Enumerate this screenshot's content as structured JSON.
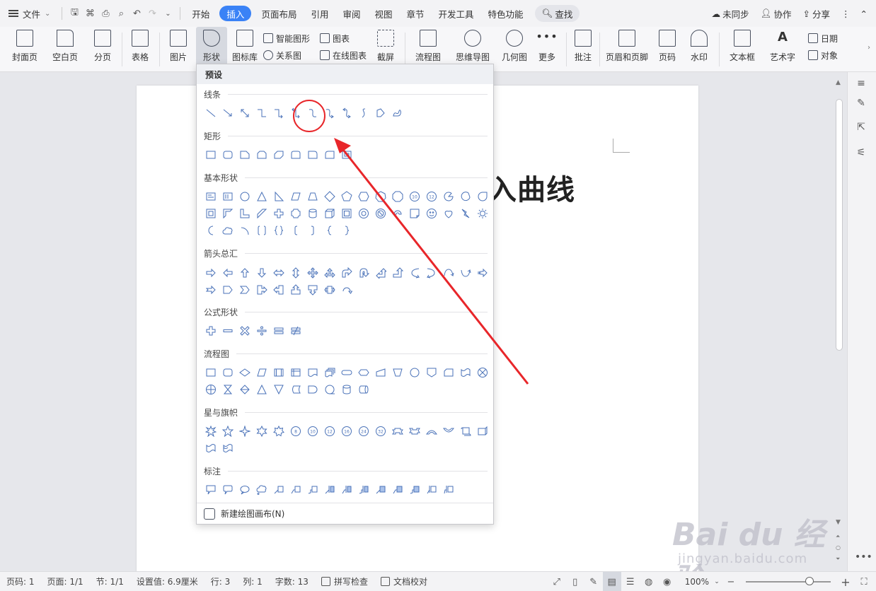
{
  "menubar": {
    "file": "文件",
    "tabs": [
      "开始",
      "插入",
      "页面布局",
      "引用",
      "审阅",
      "视图",
      "章节",
      "开发工具",
      "特色功能"
    ],
    "active_tab": "插入",
    "search": "查找",
    "sync": "未同步",
    "collab": "协作",
    "share": "分享"
  },
  "ribbon": {
    "cover": "封面页",
    "blank": "空白页",
    "page_break": "分页",
    "table": "表格",
    "picture": "图片",
    "shape": "形状",
    "icon_lib": "图标库",
    "smart_graphic": "智能图形",
    "chart": "图表",
    "relation": "关系图",
    "online_chart": "在线图表",
    "screenshot": "截屏",
    "flowchart": "流程图",
    "mindmap": "思维导图",
    "geometry": "几何图",
    "more": "更多",
    "comment": "批注",
    "header_footer": "页眉和页脚",
    "page_num": "页码",
    "watermark": "水印",
    "textbox": "文本框",
    "wordart": "艺术字",
    "date": "日期",
    "object": "对象"
  },
  "document": {
    "title_text": "入曲线"
  },
  "dropdown": {
    "header": "预设",
    "sections": {
      "lines": "线条",
      "rect": "矩形",
      "basic": "基本形状",
      "arrows": "箭头总汇",
      "formula": "公式形状",
      "flow": "流程图",
      "stars": "星与旗帜",
      "callouts": "标注"
    },
    "footer": "新建绘图画布(N)"
  },
  "statusbar": {
    "page": "页码: 1",
    "pages": "页面: 1/1",
    "section": "节: 1/1",
    "setting": "设置值: 6.9厘米",
    "row": "行: 3",
    "col": "列: 1",
    "words": "字数: 13",
    "spell": "拼写检查",
    "proof": "文档校对",
    "zoom": "100%"
  },
  "watermark": {
    "brand": "Bai du 经验",
    "url": "jingyan.baidu.com"
  },
  "colors": {
    "accent": "#3a82f6",
    "annotation": "#e8262a",
    "shape_stroke": "#4a72b8"
  }
}
